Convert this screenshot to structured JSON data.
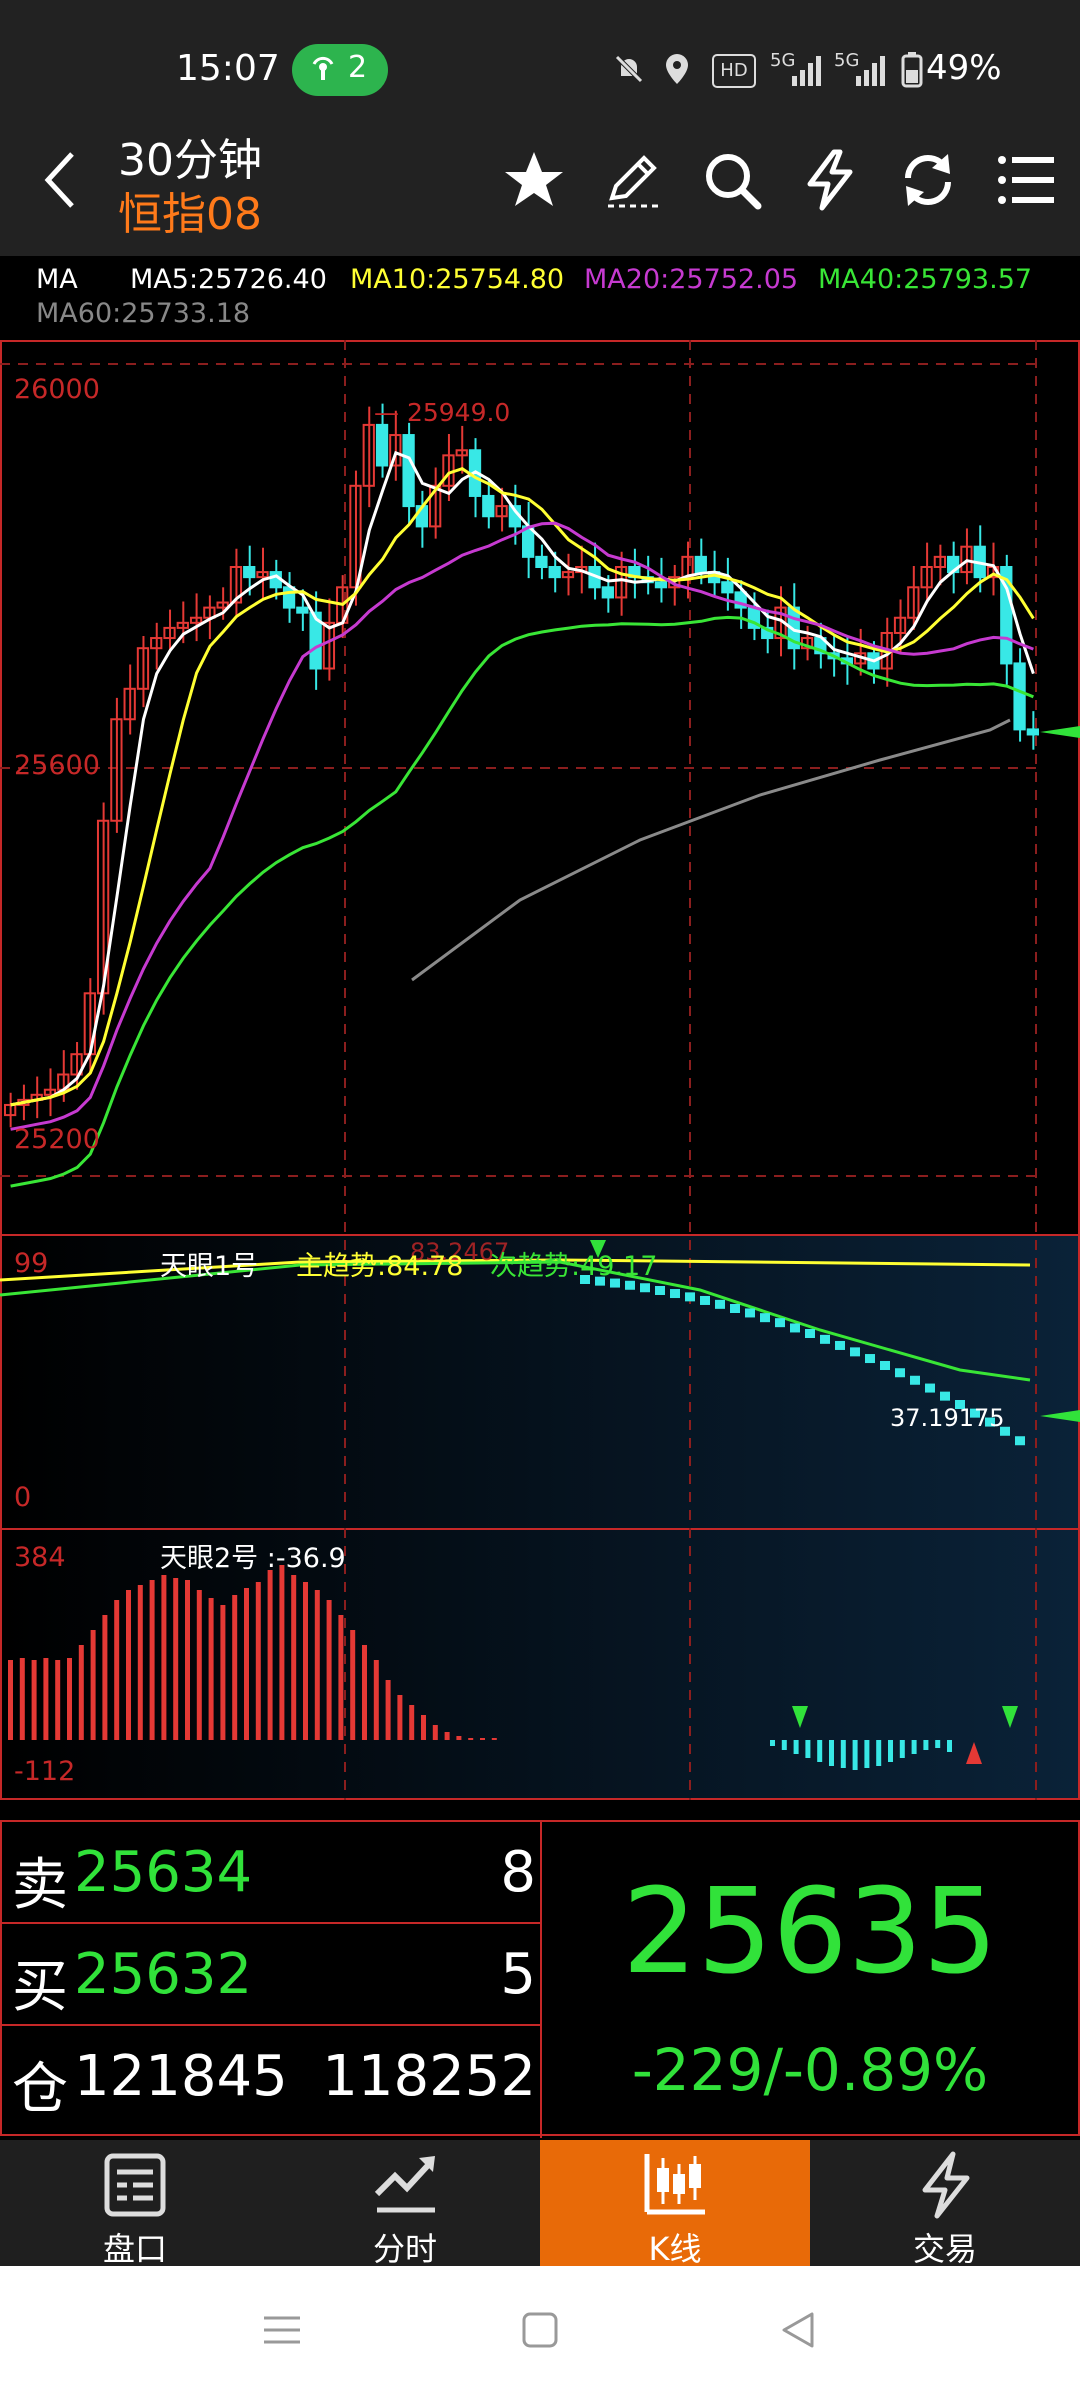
{
  "status_bar": {
    "time": "15:07",
    "hotspot_count": "2",
    "icons": [
      "mute-icon",
      "location-icon",
      "hd-icon",
      "5g-signal-icon",
      "5g-signal-icon-2",
      "battery-icon"
    ],
    "hd": "HD",
    "sig1": "5G",
    "sig2": "5G",
    "battery": "49%"
  },
  "header": {
    "period": "30分钟",
    "contract": "恒指08",
    "icons": [
      "star-icon",
      "draw-icon",
      "search-icon",
      "flash-icon",
      "refresh-icon",
      "menu-icon"
    ]
  },
  "ma_row": {
    "label": "MA",
    "ma5": "MA5:25726.40",
    "ma10": "MA10:25754.80",
    "ma20": "MA20:25752.05",
    "ma40": "MA40:25793.57",
    "ma60": "MA60:25733.18",
    "colors": {
      "ma5": "#ffffff",
      "ma10": "#ffff33",
      "ma20": "#c63ad0",
      "ma40": "#39e636",
      "ma60": "#8a8a8a"
    }
  },
  "main_chart": {
    "y_labels": [
      "26000",
      "25600",
      "25200"
    ],
    "high_label": "25949.0"
  },
  "indicator1": {
    "name": "天眼1号",
    "main_trend": "主趋势:84.78",
    "sub_trend": "次趋势:49.17",
    "overlap_text": "83.2467",
    "top_label": "99",
    "bottom_label": "0",
    "last_value": "37.19175"
  },
  "indicator2": {
    "title": "天眼2号 :-36.9",
    "top_label": "384",
    "bottom_label": "-112"
  },
  "chart_data": [
    {
      "type": "candlestick",
      "title": "",
      "ylim": [
        25100,
        26050
      ],
      "y_ticks": [
        26000,
        25600,
        25200
      ],
      "high": 25949,
      "ma": {
        "MA5": 25726.4,
        "MA10": 25754.8,
        "MA20": 25752.05,
        "MA40": 25793.57,
        "MA60": 25733.18
      }
    },
    {
      "type": "line",
      "title": "天眼1号",
      "ylim": [
        0,
        99
      ],
      "series": [
        {
          "name": "主趋势",
          "last": 84.78
        },
        {
          "name": "次趋势",
          "last": 49.17
        }
      ],
      "last_value": 37.19175
    },
    {
      "type": "bar",
      "title": "天眼2号",
      "ylim": [
        -112,
        384
      ],
      "last_value": -36.9
    }
  ],
  "quote": {
    "sell_label": "卖",
    "sell_price": "25634",
    "sell_vol": "8",
    "buy_label": "买",
    "buy_price": "25632",
    "buy_vol": "5",
    "oi_label": "仓",
    "oi_value": "121845",
    "oi_value2": "118252",
    "last_price": "25635",
    "change": "-229/-0.89%"
  },
  "bottom_nav": [
    {
      "label": "盘口",
      "icon": "orderbook-icon"
    },
    {
      "label": "分时",
      "icon": "timeshare-icon"
    },
    {
      "label": "K线",
      "icon": "candlestick-icon",
      "active": true
    },
    {
      "label": "交易",
      "icon": "trade-icon"
    }
  ]
}
